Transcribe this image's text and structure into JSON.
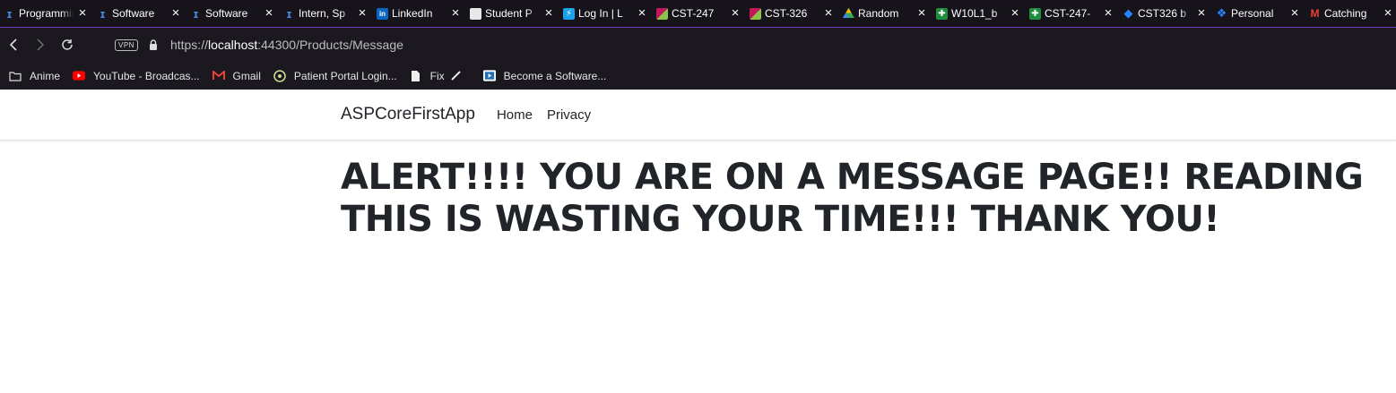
{
  "browser": {
    "tabs": [
      {
        "title": "Programming",
        "icon": "info-icon",
        "color": "#4a90e2"
      },
      {
        "title": "Software",
        "icon": "info-icon",
        "color": "#4a90e2"
      },
      {
        "title": "Software",
        "icon": "info-icon",
        "color": "#4a90e2"
      },
      {
        "title": "Intern, Sp",
        "icon": "info-icon",
        "color": "#4a90e2"
      },
      {
        "title": "LinkedIn",
        "icon": "linkedin-icon",
        "color": "#0a66c2"
      },
      {
        "title": "Student P",
        "icon": "document-icon",
        "color": "#e8e8e8"
      },
      {
        "title": "Log In | L",
        "icon": "lightning-icon",
        "color": "#1aa3e8"
      },
      {
        "title": "CST-247",
        "icon": "grid-icon",
        "color": "#c2185b"
      },
      {
        "title": "CST-326",
        "icon": "grid-icon",
        "color": "#c2185b"
      },
      {
        "title": "Random",
        "icon": "drive-icon",
        "color": "#34a853"
      },
      {
        "title": "W10L1_b",
        "icon": "sheets-icon",
        "color": "#1e8e3e"
      },
      {
        "title": "CST-247-",
        "icon": "sheets-icon",
        "color": "#1e8e3e"
      },
      {
        "title": "CST326 b",
        "icon": "jira-icon",
        "color": "#2684ff"
      },
      {
        "title": "Personal",
        "icon": "jira-icon",
        "color": "#2684ff"
      },
      {
        "title": "Catching",
        "icon": "gmail-icon",
        "color": "#ea4335"
      }
    ],
    "address": {
      "scheme": "https://",
      "host": "localhost",
      "rest": ":44300/Products/Message",
      "vpn_label": "VPN"
    },
    "bookmarks": [
      {
        "label": "Anime",
        "icon": "folder-icon"
      },
      {
        "label": "YouTube - Broadcas...",
        "icon": "youtube-icon"
      },
      {
        "label": "Gmail",
        "icon": "gmail-icon"
      },
      {
        "label": "Patient Portal Login...",
        "icon": "portal-icon"
      },
      {
        "label": "Fix",
        "icon": "document-icon"
      },
      {
        "label": "",
        "icon": "pen-icon"
      },
      {
        "label": "Become a Software...",
        "icon": "video-icon"
      }
    ]
  },
  "app": {
    "brand": "ASPCoreFirstApp",
    "nav": [
      {
        "label": "Home"
      },
      {
        "label": "Privacy"
      }
    ],
    "heading": "ALERT!!!! YOU ARE ON A MESSAGE PAGE!! READING THIS IS WASTING YOUR TIME!!! THANK YOU!"
  }
}
